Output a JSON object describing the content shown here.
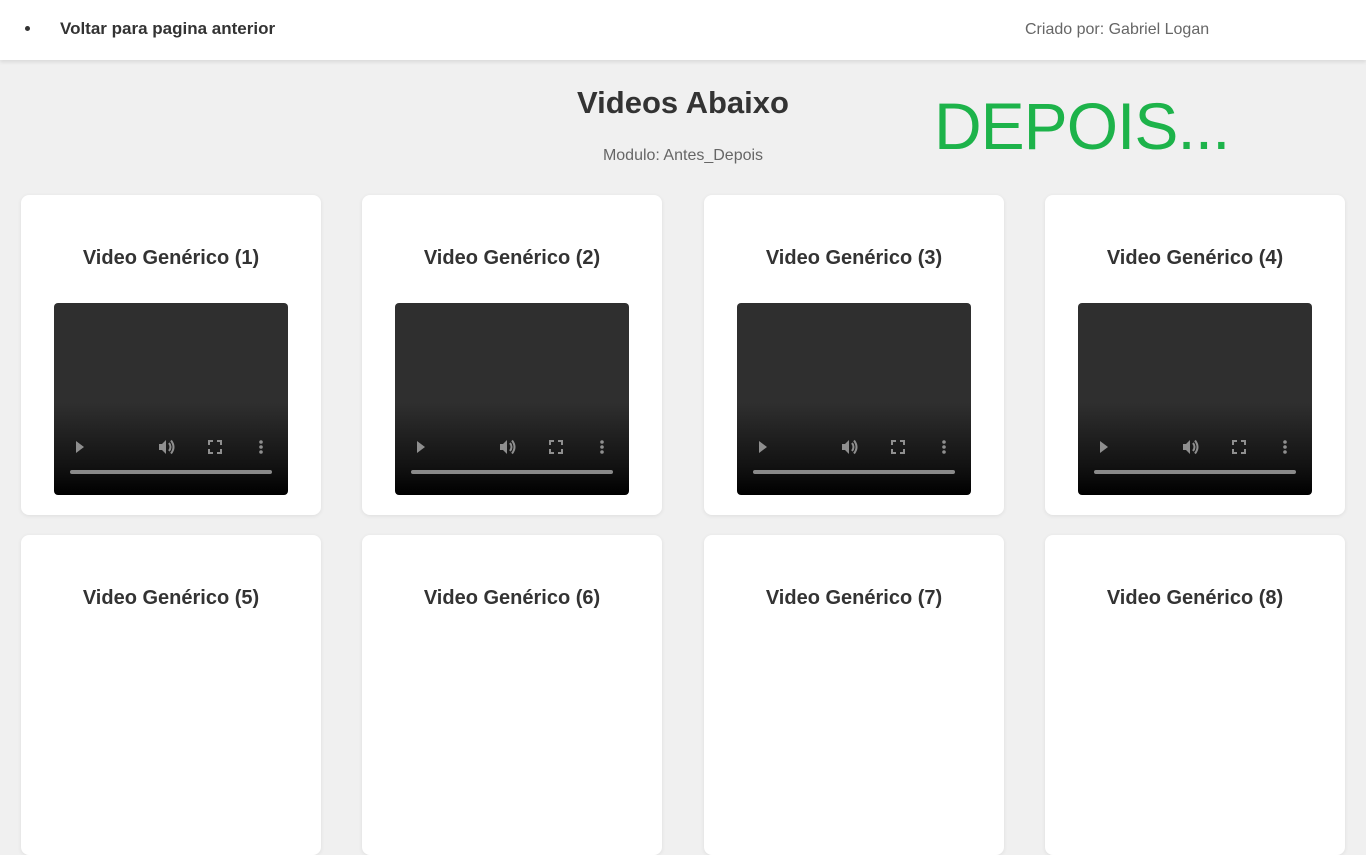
{
  "header": {
    "back_link": "Voltar para pagina anterior",
    "creator": "Criado por: Gabriel Logan"
  },
  "main": {
    "title": "Videos Abaixo",
    "subtitle": "Modulo: Antes_Depois",
    "overlay_text": "DEPOIS...",
    "overlay_color": "#1db34a"
  },
  "videos": [
    {
      "title": "Video Genérico (1)"
    },
    {
      "title": "Video Genérico (2)"
    },
    {
      "title": "Video Genérico (3)"
    },
    {
      "title": "Video Genérico (4)"
    },
    {
      "title": "Video Genérico (5)"
    },
    {
      "title": "Video Genérico (6)"
    },
    {
      "title": "Video Genérico (7)"
    },
    {
      "title": "Video Genérico (8)"
    }
  ]
}
